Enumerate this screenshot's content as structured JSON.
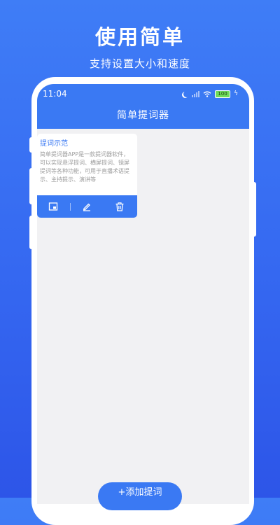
{
  "promo": {
    "title": "使用简单",
    "subtitle": "支持设置大小和速度"
  },
  "status_bar": {
    "time": "11:04",
    "battery": "100",
    "icons": [
      "moon-icon",
      "signal-icon",
      "wifi-icon",
      "battery-icon",
      "charging-icon"
    ]
  },
  "app": {
    "title": "简单提词器",
    "accent_color": "#3a79f3",
    "background_color": "#f1f1f3"
  },
  "cards": [
    {
      "title": "提词示范",
      "body": "简单提词器APP是一款提词器软件，可以实现悬浮提词、横屏提词、镜屏提词等各种功能，可用于直播术语提示、主持提示、演讲等",
      "actions": [
        "window-icon",
        "edit-icon",
        "delete-icon"
      ]
    }
  ],
  "add_button": {
    "label": "+添加提词"
  }
}
